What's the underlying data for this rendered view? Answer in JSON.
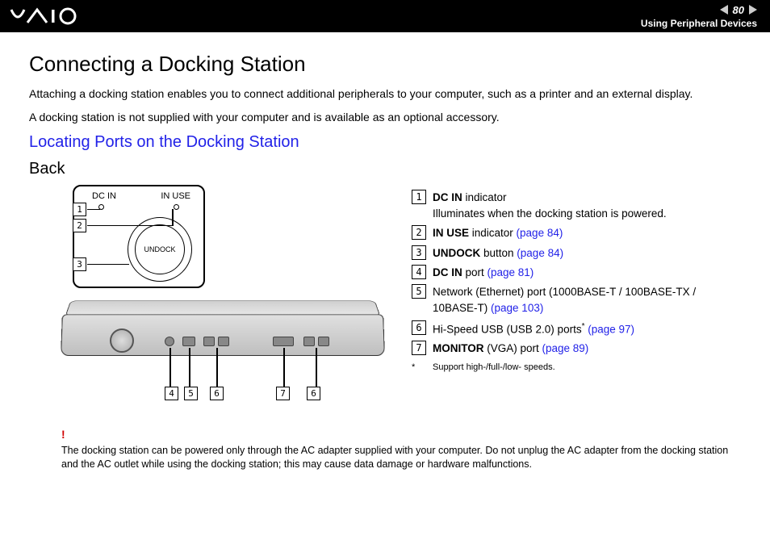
{
  "header": {
    "logo_text": "VAIO",
    "page_number": "80",
    "section_title": "Using Peripheral Devices"
  },
  "h1": "Connecting a Docking Station",
  "intro": {
    "p1": "Attaching a docking station enables you to connect additional peripherals to your computer, such as a printer and an external display.",
    "p2": "A docking station is not supplied with your computer and is available as an optional accessory."
  },
  "h2": "Locating Ports on the Docking Station",
  "h3": "Back",
  "diagram": {
    "label_dc_in": "DC IN",
    "label_in_use": "IN USE",
    "undock_label": "UNDOCK",
    "callout_1": "1",
    "callout_2": "2",
    "callout_3": "3",
    "callout_4": "4",
    "callout_5": "5",
    "callout_6": "6",
    "callout_7": "7"
  },
  "legend": {
    "i1": {
      "num": "1",
      "bold": "DC IN",
      "rest": " indicator",
      "desc": "Illuminates when the docking station is powered."
    },
    "i2": {
      "num": "2",
      "bold": "IN USE",
      "rest": " indicator ",
      "link": "(page 84)"
    },
    "i3": {
      "num": "3",
      "bold": "UNDOCK",
      "rest": " button ",
      "link": "(page 84)"
    },
    "i4": {
      "num": "4",
      "bold": "DC IN",
      "rest": " port ",
      "link": "(page 81)"
    },
    "i5": {
      "num": "5",
      "text": "Network (Ethernet) port (1000BASE-T / 100BASE-TX / 10BASE-T) ",
      "link": "(page 103)"
    },
    "i6": {
      "num": "6",
      "text": "Hi-Speed USB (USB 2.0) ports",
      "sup": "*",
      "sp": " ",
      "link": "(page 97)"
    },
    "i7": {
      "num": "7",
      "bold": "MONITOR",
      "rest": " (VGA) port ",
      "link": "(page 89)"
    },
    "footnote_mark": "*",
    "footnote": "Support high-/full-/low- speeds."
  },
  "warning": {
    "mark": "!",
    "text": "The docking station can be powered only through the AC adapter supplied with your computer. Do not unplug the AC adapter from the docking station and the AC outlet while using the docking station; this may cause data damage or hardware malfunctions."
  }
}
